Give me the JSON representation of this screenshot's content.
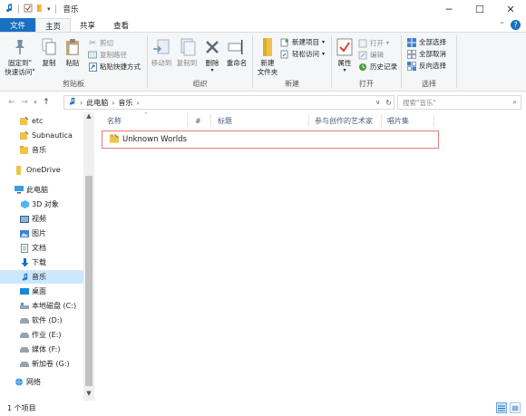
{
  "window": {
    "title": "音乐",
    "controls": {
      "minimize": "─",
      "maximize": "☐",
      "close": "✕"
    }
  },
  "ribbon_tabs": [
    {
      "label": "文件"
    },
    {
      "label": "主页"
    },
    {
      "label": "共享"
    },
    {
      "label": "查看"
    }
  ],
  "ribbon": {
    "clipboard": {
      "label": "剪贴板",
      "pin": "固定到\"快速访问\"",
      "pin_line1": "固定到\"",
      "pin_line2": "快速访问\"",
      "copy": "复制",
      "paste": "粘贴",
      "cut": "剪切",
      "copy_path": "复制路径",
      "paste_shortcut": "粘贴快捷方式"
    },
    "organize": {
      "label": "组织",
      "move_to": "移动到",
      "copy_to": "复制到",
      "delete": "删除",
      "rename": "重命名"
    },
    "new": {
      "label": "新建",
      "new_folder_line1": "新建",
      "new_folder_line2": "文件夹",
      "new_item": "新建项目",
      "easy_access": "轻松访问"
    },
    "open": {
      "label": "打开",
      "properties": "属性",
      "open": "打开",
      "edit": "编辑",
      "history": "历史记录"
    },
    "select": {
      "label": "选择",
      "select_all": "全部选择",
      "select_none": "全部取消",
      "invert": "反向选择"
    }
  },
  "address": {
    "segments": [
      "此电脑",
      "音乐"
    ],
    "search_placeholder": "搜索\"音乐\""
  },
  "nav_pane": {
    "items": [
      {
        "label": "etc",
        "icon": "folder-pinned-icon"
      },
      {
        "label": "Subnautica",
        "icon": "folder-pinned-icon"
      },
      {
        "label": "音乐",
        "icon": "folder-icon"
      },
      {
        "label": "OneDrive",
        "icon": "onedrive-icon"
      },
      {
        "label": "此电脑",
        "icon": "this-pc-icon"
      },
      {
        "label": "3D 对象",
        "icon": "3d-objects-icon"
      },
      {
        "label": "视频",
        "icon": "videos-icon"
      },
      {
        "label": "图片",
        "icon": "pictures-icon"
      },
      {
        "label": "文档",
        "icon": "documents-icon"
      },
      {
        "label": "下载",
        "icon": "downloads-icon"
      },
      {
        "label": "音乐",
        "icon": "music-icon"
      },
      {
        "label": "桌面",
        "icon": "desktop-icon"
      },
      {
        "label": "本地磁盘 (C:)",
        "icon": "drive-c-icon"
      },
      {
        "label": "软件 (D:)",
        "icon": "drive-icon"
      },
      {
        "label": "作业 (E:)",
        "icon": "drive-icon"
      },
      {
        "label": "媒体 (F:)",
        "icon": "drive-icon"
      },
      {
        "label": "新加卷 (G:)",
        "icon": "drive-icon"
      },
      {
        "label": "网络",
        "icon": "network-icon"
      }
    ],
    "selected_index": 10
  },
  "file_list": {
    "columns": [
      "名称",
      "#",
      "标题",
      "参与创作的艺术家",
      "唱片集"
    ],
    "rows": [
      {
        "name": "Unknown Worlds",
        "type": "folder"
      }
    ]
  },
  "status": {
    "item_count": "1 个项目"
  },
  "colors": {
    "accent": "#1a6fc0",
    "selection": "#cce8ff",
    "highlight_border": "#e87a7a",
    "folder": "#f1c24a"
  }
}
